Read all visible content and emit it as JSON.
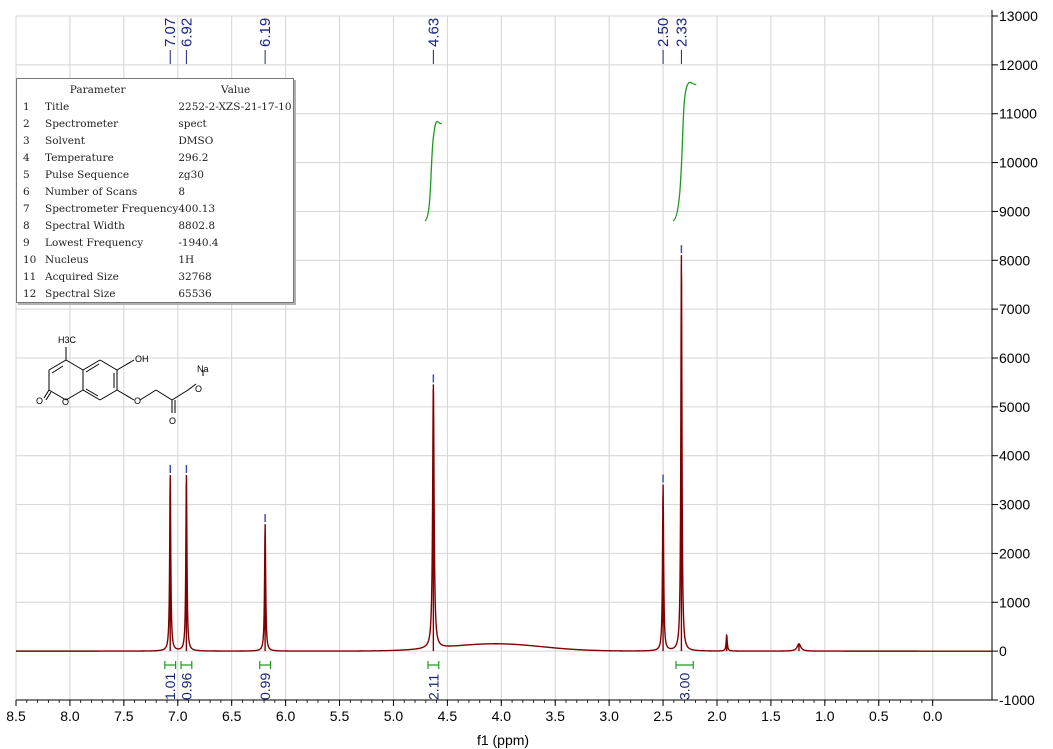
{
  "chart_data": {
    "type": "line",
    "xlabel": "f1 (ppm)",
    "ylabel": "",
    "title": "",
    "xlim": [
      8.5,
      -0.55
    ],
    "ylim": [
      -1000,
      13000
    ],
    "x_ticks": [
      8.5,
      8.0,
      7.5,
      7.0,
      6.5,
      6.0,
      5.5,
      5.0,
      4.5,
      4.0,
      3.5,
      3.0,
      2.5,
      2.0,
      1.5,
      1.0,
      0.5,
      0.0
    ],
    "x_tick_labels": [
      "8.5",
      "8.0",
      "7.5",
      "7.0",
      "6.5",
      "6.0",
      "5.5",
      "5.0",
      "4.5",
      "4.0",
      "3.5",
      "3.0",
      "2.5",
      "2.0",
      "1.5",
      "1.0",
      "0.5",
      "0.0"
    ],
    "y_ticks": [
      13000,
      12000,
      11000,
      10000,
      9000,
      8000,
      7000,
      6000,
      5000,
      4000,
      3000,
      2000,
      1000,
      0,
      -1000
    ],
    "y_tick_labels": [
      "13000",
      "12000",
      "11000",
      "10000",
      "9000",
      "8000",
      "7000",
      "6000",
      "5000",
      "4000",
      "3000",
      "2000",
      "1000",
      "0",
      "-1000"
    ],
    "grid": true,
    "spectrum_color": "#7f0000",
    "integral_color": "#1e9a1e",
    "label_color": "#1a237e",
    "peaks": [
      {
        "ppm": 7.07,
        "height": 3600,
        "width": 0.006,
        "label": "7.07"
      },
      {
        "ppm": 6.92,
        "height": 3600,
        "width": 0.006,
        "label": "6.92"
      },
      {
        "ppm": 6.19,
        "height": 2600,
        "width": 0.006,
        "label": "6.19"
      },
      {
        "ppm": 4.63,
        "height": 5400,
        "width": 0.008,
        "label": "4.63"
      },
      {
        "ppm": 2.5,
        "height": 3400,
        "width": 0.006,
        "label": "2.50"
      },
      {
        "ppm": 2.33,
        "height": 8100,
        "width": 0.006,
        "label": "2.33"
      },
      {
        "ppm": 1.91,
        "height": 330,
        "width": 0.006,
        "label": ""
      },
      {
        "ppm": 1.24,
        "height": 150,
        "width": 0.02,
        "label": ""
      }
    ],
    "broad_hump": {
      "center_ppm": 4.05,
      "height": 150,
      "width": 0.6
    },
    "integrals": [
      {
        "from": 7.12,
        "to": 7.02,
        "value": "1.01",
        "y_start": 8850,
        "y_end": 9700
      },
      {
        "from": 6.97,
        "to": 6.87,
        "value": "0.96",
        "y_start": 8900,
        "y_end": 9700
      },
      {
        "from": 6.24,
        "to": 6.14,
        "value": "0.99",
        "y_start": 8850,
        "y_end": 9750
      },
      {
        "from": 4.68,
        "to": 4.58,
        "value": "2.11",
        "y_start": 8850,
        "y_end": 10800
      },
      {
        "from": 2.38,
        "to": 2.22,
        "value": "3.00",
        "y_start": 8850,
        "y_end": 11600
      }
    ]
  },
  "parameters": {
    "header_param": "Parameter",
    "header_value": "Value",
    "rows": [
      {
        "num": "1",
        "name": "Title",
        "value": "2252-2-XZS-21-17-10"
      },
      {
        "num": "2",
        "name": "Spectrometer",
        "value": "spect"
      },
      {
        "num": "3",
        "name": "Solvent",
        "value": "DMSO"
      },
      {
        "num": "4",
        "name": "Temperature",
        "value": "296.2"
      },
      {
        "num": "5",
        "name": "Pulse Sequence",
        "value": "zg30"
      },
      {
        "num": "6",
        "name": "Number of Scans",
        "value": "8"
      },
      {
        "num": "7",
        "name": "Spectrometer Frequency",
        "value": "400.13"
      },
      {
        "num": "8",
        "name": "Spectral Width",
        "value": "8802.8"
      },
      {
        "num": "9",
        "name": "Lowest Frequency",
        "value": "-1940.4"
      },
      {
        "num": "10",
        "name": "Nucleus",
        "value": "1H"
      },
      {
        "num": "11",
        "name": "Acquired Size",
        "value": "32768"
      },
      {
        "num": "12",
        "name": "Spectral Size",
        "value": "65536"
      }
    ]
  },
  "structure": {
    "methyl_label": "H3C",
    "hydroxyl_label": "OH",
    "sodium_label": "Na",
    "oxygen_label": "O"
  }
}
